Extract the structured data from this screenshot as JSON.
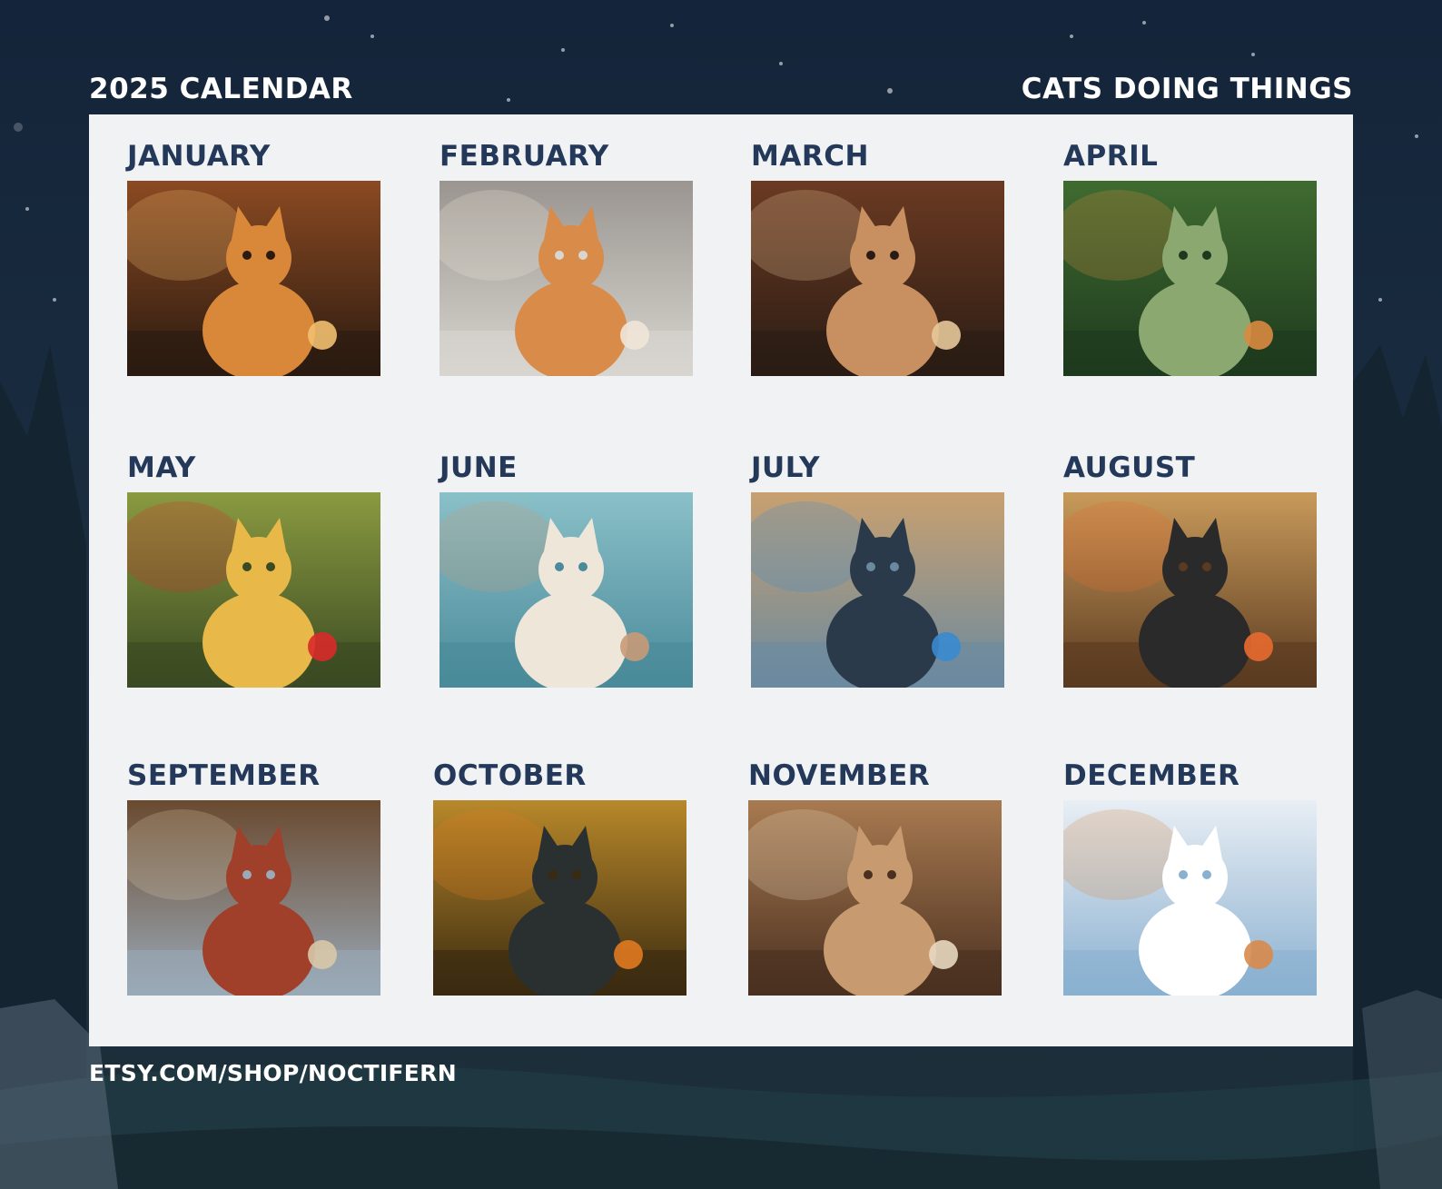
{
  "header": {
    "left_title": "2025 CALENDAR",
    "right_title": "CATS DOING THINGS"
  },
  "months": [
    {
      "label": "JANUARY",
      "palette": [
        "#2a1a10",
        "#8b4a22",
        "#d9883a",
        "#f2c070"
      ]
    },
    {
      "label": "FEBRUARY",
      "palette": [
        "#d8d6d0",
        "#9a9590",
        "#d98b4a",
        "#f0e6d8"
      ]
    },
    {
      "label": "MARCH",
      "palette": [
        "#2a1c14",
        "#6b3a22",
        "#c89060",
        "#e8c89a"
      ]
    },
    {
      "label": "APRIL",
      "palette": [
        "#1e3a1e",
        "#3f6b30",
        "#8aa870",
        "#d98a40"
      ]
    },
    {
      "label": "MAY",
      "palette": [
        "#3a4a22",
        "#8a9a40",
        "#e8b848",
        "#d82a2a"
      ]
    },
    {
      "label": "JUNE",
      "palette": [
        "#4a8a9a",
        "#8ac0c8",
        "#efe6da",
        "#c89a78"
      ]
    },
    {
      "label": "JULY",
      "palette": [
        "#6a8aa0",
        "#c8a070",
        "#2a3a4a",
        "#3a8ad0"
      ]
    },
    {
      "label": "AUGUST",
      "palette": [
        "#5a3a20",
        "#c89a5a",
        "#2a2a2a",
        "#e86a30"
      ]
    },
    {
      "label": "SEPTEMBER",
      "palette": [
        "#9aaab8",
        "#6a4a30",
        "#a0402a",
        "#d8c8a8"
      ]
    },
    {
      "label": "OCTOBER",
      "palette": [
        "#3a2a10",
        "#b8882a",
        "#2a3030",
        "#e07a20"
      ]
    },
    {
      "label": "NOVEMBER",
      "palette": [
        "#4a3020",
        "#a87a50",
        "#c89a70",
        "#e8d8c0"
      ]
    },
    {
      "label": "DECEMBER",
      "palette": [
        "#8ab0d0",
        "#e8eef4",
        "#ffffff",
        "#d88a4a"
      ]
    }
  ],
  "footer": {
    "shop_url": "ETSY.COM/SHOP/NOCTIFERN"
  },
  "colors": {
    "month_label": "#24395a",
    "panel": "#f1f2f4",
    "background": "#1a2d3f"
  }
}
